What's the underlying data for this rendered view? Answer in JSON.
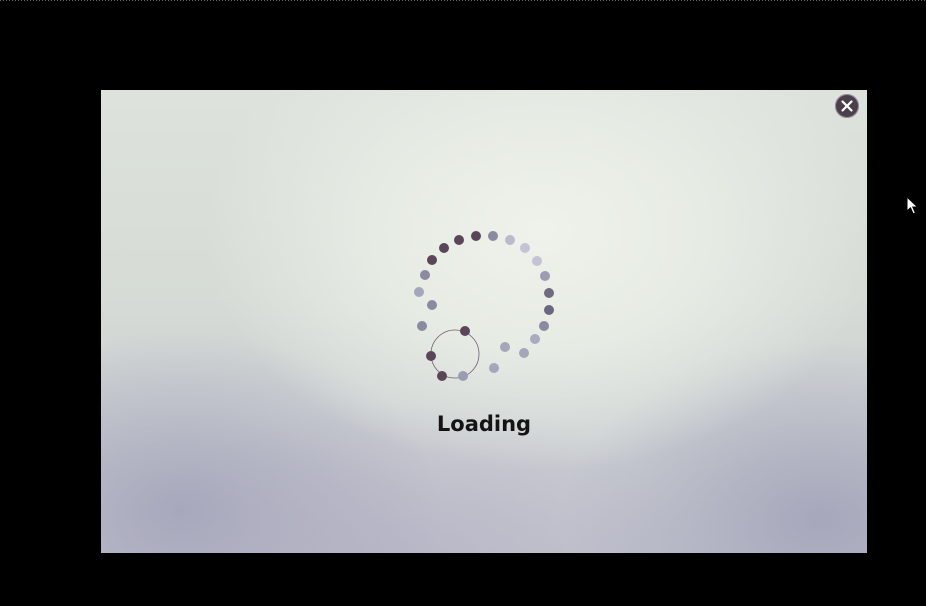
{
  "dialog": {
    "status_text": "Loading"
  },
  "icons": {
    "close": "close-icon",
    "spinner": "loading-spinner-icon",
    "cursor": "mouse-pointer-icon"
  },
  "colors": {
    "backdrop": "#000000",
    "dot_dark": "#5a4658",
    "dot_mid": "#8a8aa0",
    "dot_light": "#c2c4d4",
    "text": "#141414",
    "close_button": "#4a3f4a"
  }
}
